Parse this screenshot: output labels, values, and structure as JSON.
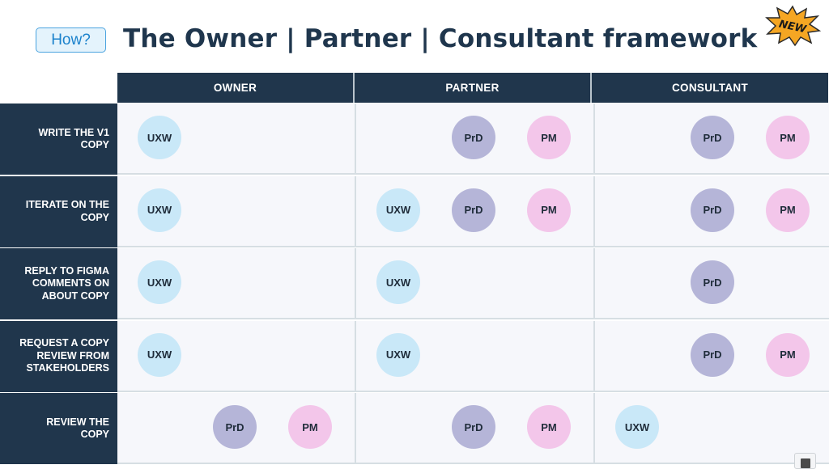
{
  "header": {
    "how_label": "How?",
    "title": "The Owner | Partner | Consultant framework",
    "badge": "NEW"
  },
  "colors": {
    "navy": "#20364c",
    "uxw": "#c9e8f8",
    "prd": "#b5b5d8",
    "pm": "#f3c6ea",
    "badge": "#f5a623"
  },
  "columns": [
    "OWNER",
    "PARTNER",
    "CONSULTANT"
  ],
  "rows": [
    {
      "label": "WRITE THE V1\nCOPY",
      "cells": [
        [
          {
            "slot": 0,
            "role": "UXW"
          }
        ],
        [
          {
            "slot": 1,
            "role": "PrD"
          },
          {
            "slot": 2,
            "role": "PM"
          }
        ],
        [
          {
            "slot": 1,
            "role": "PrD"
          },
          {
            "slot": 2,
            "role": "PM"
          }
        ]
      ]
    },
    {
      "label": "ITERATE ON THE\nCOPY",
      "cells": [
        [
          {
            "slot": 0,
            "role": "UXW"
          }
        ],
        [
          {
            "slot": 0,
            "role": "UXW"
          },
          {
            "slot": 1,
            "role": "PrD"
          },
          {
            "slot": 2,
            "role": "PM"
          }
        ],
        [
          {
            "slot": 1,
            "role": "PrD"
          },
          {
            "slot": 2,
            "role": "PM"
          }
        ]
      ]
    },
    {
      "label": "REPLY TO FIGMA\nCOMMENTS ON\nABOUT COPY",
      "cells": [
        [
          {
            "slot": 0,
            "role": "UXW"
          }
        ],
        [
          {
            "slot": 0,
            "role": "UXW"
          }
        ],
        [
          {
            "slot": 1,
            "role": "PrD"
          }
        ]
      ]
    },
    {
      "label": "REQUEST A COPY\nREVIEW FROM\nSTAKEHOLDERS",
      "cells": [
        [
          {
            "slot": 0,
            "role": "UXW"
          }
        ],
        [
          {
            "slot": 0,
            "role": "UXW"
          }
        ],
        [
          {
            "slot": 1,
            "role": "PrD"
          },
          {
            "slot": 2,
            "role": "PM"
          }
        ]
      ]
    },
    {
      "label": "REVIEW THE\nCOPY",
      "cells": [
        [
          {
            "slot": 1,
            "role": "PrD"
          },
          {
            "slot": 2,
            "role": "PM"
          }
        ],
        [
          {
            "slot": 1,
            "role": "PrD"
          },
          {
            "slot": 2,
            "role": "PM"
          }
        ],
        [
          {
            "slot": 0,
            "role": "UXW"
          }
        ]
      ]
    }
  ]
}
